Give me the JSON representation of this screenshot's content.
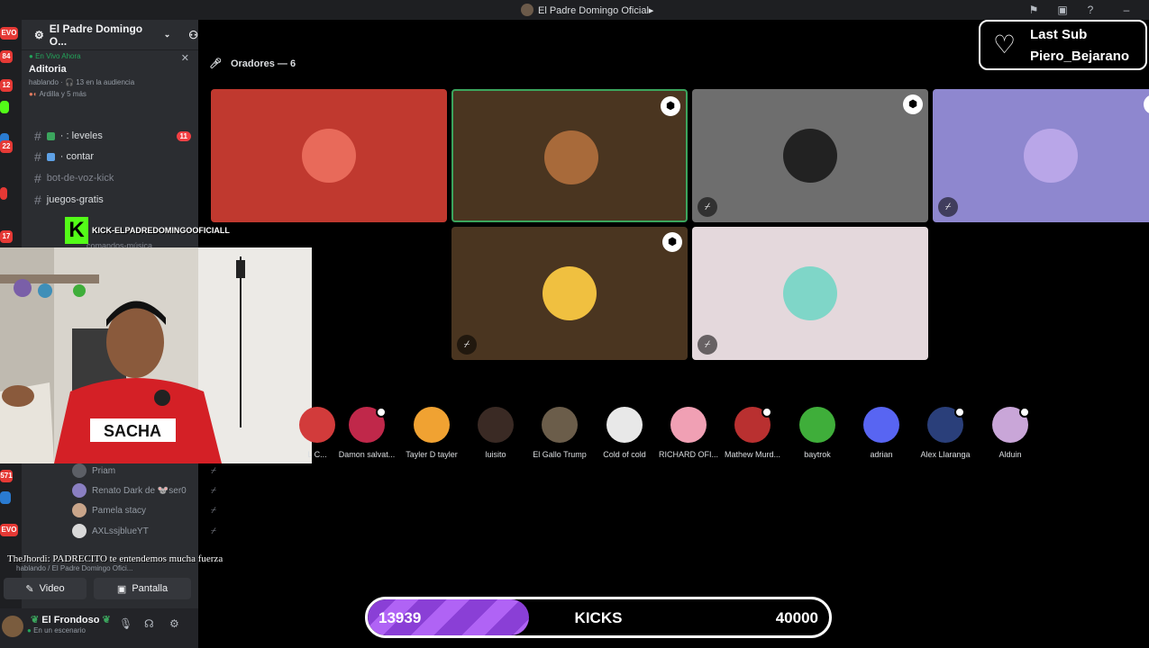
{
  "window": {
    "title": "El Padre Domingo Oficial▸"
  },
  "server": {
    "name": "El Padre Domingo O..."
  },
  "live_card": {
    "live_label": "En Vivo Ahora",
    "stage_name": "Aditoria",
    "meta": "hablando · 🎧 13 en la audiencia",
    "members": "Ardilla y 5 más"
  },
  "channels": [
    {
      "name": "· : leveles",
      "badge": "11"
    },
    {
      "name": "· contar"
    },
    {
      "name": "bot-de-voz-kick"
    },
    {
      "name": "juegos-gratis"
    },
    {
      "name": "comandos-música"
    }
  ],
  "kick_overlay": {
    "letter": "K",
    "username": "KICK-ELPADREDOMINGOOFICIALL"
  },
  "stage": {
    "speakers_label": "Oradores — 6"
  },
  "sidebar_users": [
    {
      "name": "Priam"
    },
    {
      "name": "Renato Dark de 🐭ser0"
    },
    {
      "name": "Pamela stacy"
    },
    {
      "name": "AXLssjblueYT"
    }
  ],
  "chat": {
    "message": "TheJhordi: PADRECITO te entendemos mucha fuerza",
    "subline": "hablando / El Padre Domingo Ofici..."
  },
  "buttons": {
    "video": "Video",
    "screen": "Pantalla"
  },
  "current_user": {
    "name": "El Frondoso",
    "status": "En un escenario"
  },
  "audience": [
    {
      "name": "L C...",
      "color": "#d23b3b"
    },
    {
      "name": "Damon salvat...",
      "color": "#c0284a"
    },
    {
      "name": "Tayler D tayler",
      "color": "#f0a232"
    },
    {
      "name": "luisito",
      "color": "#3a2a24"
    },
    {
      "name": "El Gallo Trump",
      "color": "#6b5d4a"
    },
    {
      "name": "Cold of cold",
      "color": "#e8e8e8"
    },
    {
      "name": "RICHARD OFI...",
      "color": "#f0a0b4"
    },
    {
      "name": "Mathew Murd...",
      "color": "#b93030"
    },
    {
      "name": "baytrok",
      "color": "#3fae3a"
    },
    {
      "name": "adrian",
      "color": "#5865f2"
    },
    {
      "name": "Alex Llaranga",
      "color": "#2a3f7a"
    },
    {
      "name": "Alduin",
      "color": "#c9a6d8"
    }
  ],
  "tiles_colors": {
    "t1": "#c0392f",
    "t2": "#4a3520",
    "t3": "#6e6e6e",
    "t4": "#8e87cf",
    "t5": "#4a3520",
    "t6": "#e4d8dc"
  },
  "last_sub": {
    "title": "Last Sub",
    "user": "Piero_Bejarano"
  },
  "kicks": {
    "current": "13939",
    "label": "KICKS",
    "goal": "40000",
    "progress": 0.35
  }
}
